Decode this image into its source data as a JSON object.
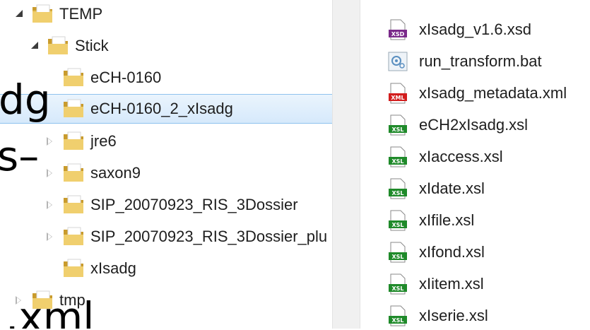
{
  "tree": {
    "items": [
      {
        "label": "TEMP",
        "state": "expanded",
        "selected": false
      },
      {
        "label": "Stick",
        "state": "expanded",
        "selected": false
      },
      {
        "label": "eCH-0160",
        "state": "none",
        "selected": false
      },
      {
        "label": "eCH-0160_2_xIsadg",
        "state": "none",
        "selected": true
      },
      {
        "label": "jre6",
        "state": "collapsed",
        "selected": false
      },
      {
        "label": "saxon9",
        "state": "collapsed",
        "selected": false
      },
      {
        "label": "SIP_20070923_RIS_3Dossier",
        "state": "collapsed",
        "selected": false
      },
      {
        "label": "SIP_20070923_RIS_3Dossier_plu",
        "state": "collapsed",
        "selected": false
      },
      {
        "label": "xIsadg",
        "state": "none",
        "selected": false
      },
      {
        "label": "tmp",
        "state": "collapsed",
        "selected": false
      }
    ]
  },
  "overlay_text": {
    "line1": "dg",
    "line2": "s–",
    "line3": ".xml"
  },
  "files": {
    "items": [
      {
        "name": "xIsadg_v1.6.xsd",
        "type": "xsd-file-icon",
        "badge": "XSD",
        "color": "#7a2a8a"
      },
      {
        "name": "run_transform.bat",
        "type": "bat-file-icon",
        "badge": "",
        "color": "#5a8fc0"
      },
      {
        "name": "xIsadg_metadata.xml",
        "type": "xml-file-icon",
        "badge": "XML",
        "color": "#d21d1d"
      },
      {
        "name": "eCH2xIsadg.xsl",
        "type": "xsl-file-icon",
        "badge": "XSL",
        "color": "#1f8a2a"
      },
      {
        "name": "xIaccess.xsl",
        "type": "xsl-file-icon",
        "badge": "XSL",
        "color": "#1f8a2a"
      },
      {
        "name": "xIdate.xsl",
        "type": "xsl-file-icon",
        "badge": "XSL",
        "color": "#1f8a2a"
      },
      {
        "name": "xIfile.xsl",
        "type": "xsl-file-icon",
        "badge": "XSL",
        "color": "#1f8a2a"
      },
      {
        "name": "xIfond.xsl",
        "type": "xsl-file-icon",
        "badge": "XSL",
        "color": "#1f8a2a"
      },
      {
        "name": "xIitem.xsl",
        "type": "xsl-file-icon",
        "badge": "XSL",
        "color": "#1f8a2a"
      },
      {
        "name": "xIserie.xsl",
        "type": "xsl-file-icon",
        "badge": "XSL",
        "color": "#1f8a2a"
      }
    ]
  },
  "colors": {
    "selection_border": "#8ec2ee",
    "folder_main": "#e8c35a",
    "folder_dark": "#c99b2c"
  }
}
